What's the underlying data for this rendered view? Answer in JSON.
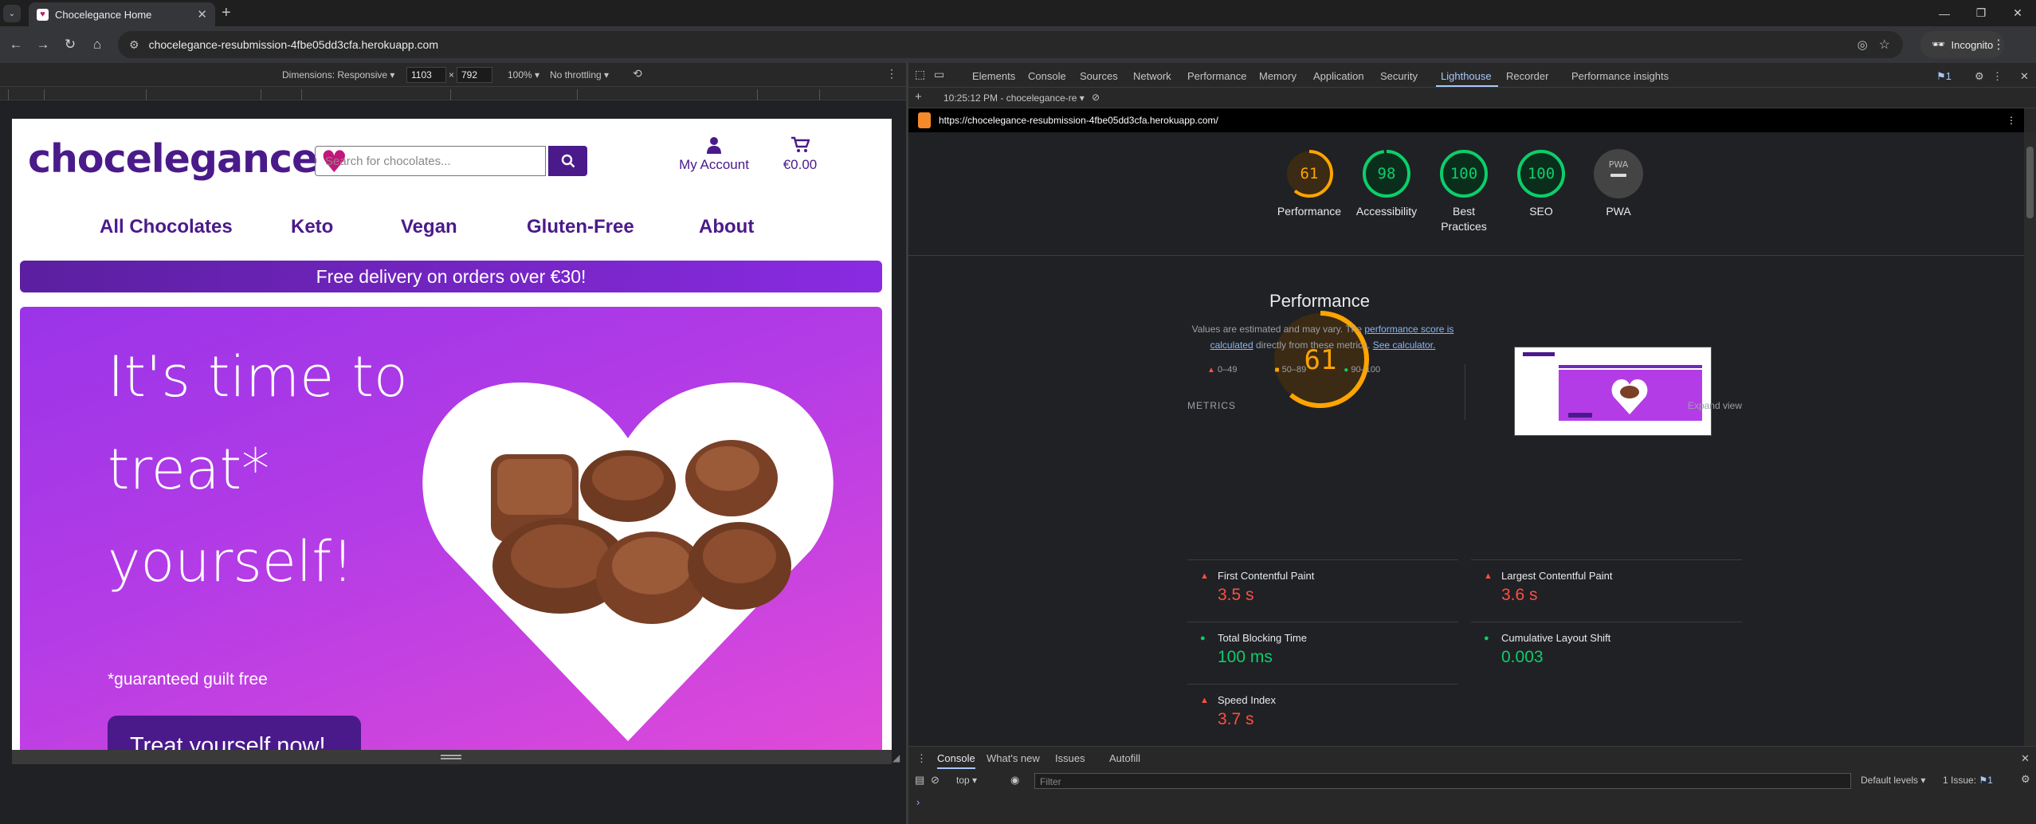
{
  "browser": {
    "tab_title": "Chocelegance Home",
    "new_tab": "+",
    "url": "chocelegance-resubmission-4fbe05dd3cfa.herokuapp.com",
    "incognito_label": "Incognito"
  },
  "device_toolbar": {
    "dimensions": "Dimensions: Responsive ▾",
    "width": "1103",
    "times": "×",
    "height": "792",
    "zoom": "100% ▾",
    "throttling": "No throttling ▾"
  },
  "site": {
    "logo": "chocelegance",
    "search_placeholder": "Search for chocolates...",
    "account_label": "My Account",
    "cart_total": "€0.00",
    "nav": [
      "All Chocolates",
      "Keto",
      "Vegan",
      "Gluten-Free",
      "About"
    ],
    "promo": "Free delivery on orders over €30!",
    "hero_lines": [
      "It's time to",
      "treat*",
      "yourself!"
    ],
    "guilt_note": "*guaranteed guilt free",
    "cta": "Treat yourself now!"
  },
  "devtools": {
    "tabs": [
      "Elements",
      "Console",
      "Sources",
      "Network",
      "Performance",
      "Memory",
      "Application",
      "Security",
      "Lighthouse",
      "Recorder",
      "Performance insights"
    ],
    "active_tab": "Lighthouse",
    "issue_badge": "1",
    "report_selector": "10:25:12 PM - chocelegance-re ▾",
    "report_url": "https://chocelegance-resubmission-4fbe05dd3cfa.herokuapp.com/"
  },
  "lighthouse": {
    "scores": [
      {
        "label": "Performance",
        "value": "61",
        "color": "#ffa400"
      },
      {
        "label": "Accessibility",
        "value": "98",
        "color": "#0cce6b"
      },
      {
        "label": "Best Practices",
        "value": "100",
        "color": "#0cce6b"
      },
      {
        "label": "SEO",
        "value": "100",
        "color": "#0cce6b"
      },
      {
        "label": "PWA",
        "value": "PWA",
        "color": "#9aa0a6"
      }
    ],
    "big_score": "61",
    "big_label": "Performance",
    "note_prefix": "Values are estimated and may vary. The ",
    "note_link1": "performance score is calculated",
    "note_mid": " directly from these metrics. ",
    "note_link2": "See calculator.",
    "legend": [
      "0–49",
      "50–89",
      "90–100"
    ],
    "metrics_header": "METRICS",
    "expand_view": "Expand view",
    "metrics": [
      {
        "name": "First Contentful Paint",
        "value": "3.5 s",
        "status": "red"
      },
      {
        "name": "Largest Contentful Paint",
        "value": "3.6 s",
        "status": "red"
      },
      {
        "name": "Total Blocking Time",
        "value": "100 ms",
        "status": "green"
      },
      {
        "name": "Cumulative Layout Shift",
        "value": "0.003",
        "status": "green"
      },
      {
        "name": "Speed Index",
        "value": "3.7 s",
        "status": "red"
      }
    ]
  },
  "console_drawer": {
    "tabs": [
      "Console",
      "What's new",
      "Issues",
      "Autofill"
    ],
    "context": "top ▾",
    "filter_placeholder": "Filter",
    "levels": "Default levels ▾",
    "issues": "1 Issue:",
    "issues_count": "1",
    "prompt": "›"
  }
}
